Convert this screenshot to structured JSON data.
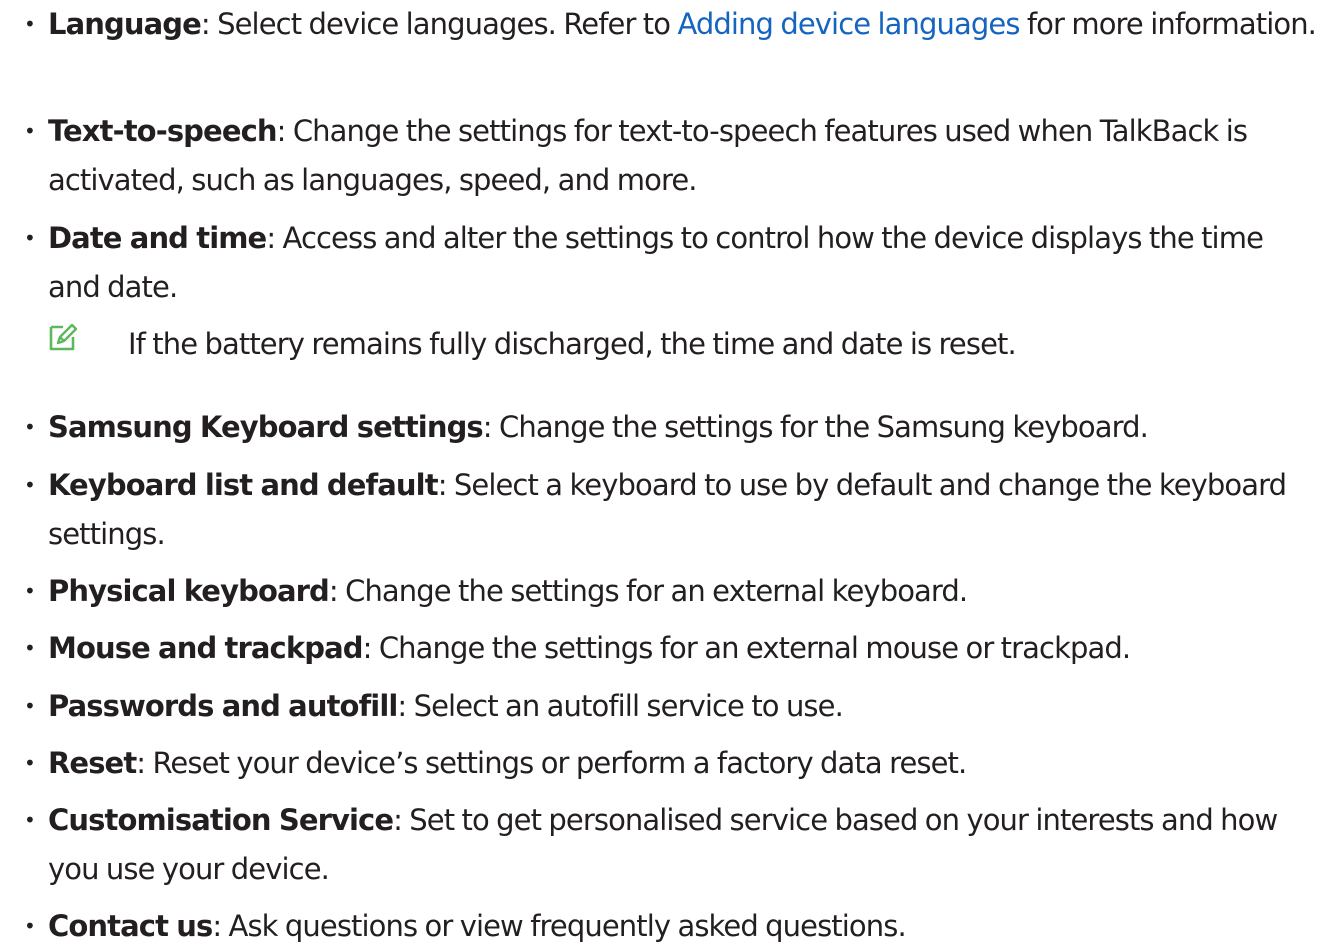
{
  "items": [
    {
      "term": "Language",
      "pre": ": Select device languages. Refer to ",
      "link": "Adding device languages",
      "post": " for more information."
    },
    {
      "term": "Text-to-speech",
      "desc": ": Change the settings for text-to-speech features used when TalkBack is activated, such as languages, speed, and more."
    },
    {
      "term": "Date and time",
      "desc": ": Access and alter the settings to control how the device displays the time and date."
    },
    {
      "term": "Samsung Keyboard settings",
      "desc": ": Change the settings for the Samsung keyboard."
    },
    {
      "term": "Keyboard list and default",
      "desc": ": Select a keyboard to use by default and change the keyboard settings."
    },
    {
      "term": "Physical keyboard",
      "desc": ": Change the settings for an external keyboard."
    },
    {
      "term": "Mouse and trackpad",
      "desc": ": Change the settings for an external mouse or trackpad."
    },
    {
      "term": "Passwords and autofill",
      "desc": ": Select an autofill service to use."
    },
    {
      "term": "Reset",
      "desc": ": Reset your device’s settings or perform a factory data reset."
    },
    {
      "term": "Customisation Service",
      "desc": ": Set to get personalised service based on your interests and how you use your device."
    },
    {
      "term": "Contact us",
      "desc": ": Ask questions or view frequently asked questions."
    }
  ],
  "bullet_char": "•",
  "note": {
    "icon": "note-pencil-icon",
    "text": "If the battery remains fully discharged, the time and date is reset."
  },
  "colors": {
    "text": "#231f20",
    "link": "#1565c0",
    "note_icon": "#5cb85c"
  }
}
